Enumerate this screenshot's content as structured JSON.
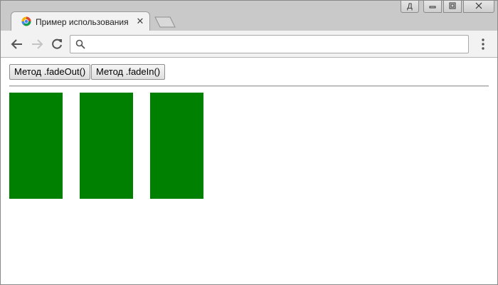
{
  "browser": {
    "tab_title": "Пример использования jQuery",
    "tab_close": "✕",
    "profile_label": "Д",
    "address_value": "",
    "colors": {
      "chrome": "#c9c9c9",
      "toolbar": "#f2f2f2"
    }
  },
  "page": {
    "buttons": [
      {
        "label": "Метод .fadeOut()"
      },
      {
        "label": "Метод .fadeIn()"
      }
    ],
    "blocks": [
      {
        "color": "#008000"
      },
      {
        "color": "#008000"
      },
      {
        "color": "#008000"
      }
    ]
  }
}
